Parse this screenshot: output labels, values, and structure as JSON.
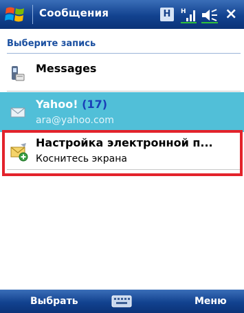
{
  "titlebar": {
    "title": "Сообщения",
    "status_badge": "H",
    "icons": [
      "windows-flag-icon",
      "signal-icon",
      "speaker-icon",
      "close-icon"
    ],
    "close_glyph": "×"
  },
  "list": {
    "header": "Выберите запись",
    "items": [
      {
        "title": "Messages",
        "icon": "phone-icon"
      },
      {
        "title": "Yahoo!",
        "count": "(17)",
        "subtitle": "ara@yahoo.com",
        "icon": "envelope-icon",
        "selected": true
      },
      {
        "title": "Настройка электронной п...",
        "subtitle": "Коснитесь экрана",
        "icon": "email-setup-icon"
      }
    ]
  },
  "menubar": {
    "left_softkey": "Выбрать",
    "right_softkey": "Меню",
    "center_icon": "keyboard-icon"
  },
  "colors": {
    "titlebar": "#12428f",
    "selected_row": "#51bfd8",
    "highlight_frame": "#e3232b",
    "header_text": "#1a4fa0"
  }
}
